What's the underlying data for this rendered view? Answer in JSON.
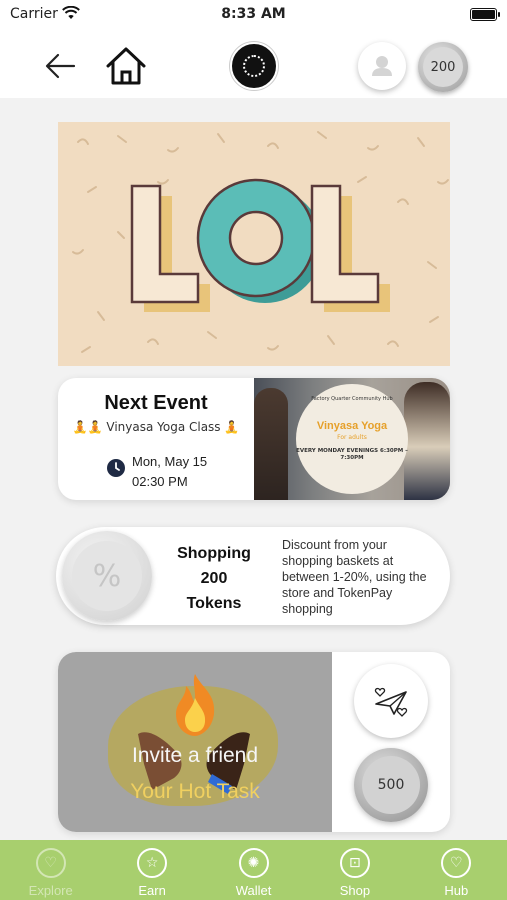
{
  "status_bar": {
    "carrier": "Carrier",
    "time": "8:33 AM"
  },
  "header": {
    "coin_balance": "200"
  },
  "banner": {
    "text": "LOL"
  },
  "next_event": {
    "title": "Next Event",
    "subtitle": "🧘🧘 Vinyasa Yoga Class 🧘",
    "date": "Mon, May 15",
    "time": "02:30 PM",
    "poster": {
      "heading": "Factory Quarter Community Hub",
      "title": "Vinyasa Yoga",
      "subtitle": "For adults",
      "schedule": "EVERY MONDAY EVENINGS 6:30PM – 7:30PM"
    }
  },
  "shopping": {
    "line1": "Shopping",
    "line2": "200",
    "line3": "Tokens",
    "symbol": "%",
    "description": "Discount from your shopping baskets at between 1-20%, using the store and TokenPay shopping"
  },
  "hot_task": {
    "title": "Invite a friend",
    "subtitle": "Your Hot Task",
    "reward": "500"
  },
  "tabs": [
    {
      "label": "Explore",
      "icon": "heart-circle-icon",
      "active": true
    },
    {
      "label": "Earn",
      "icon": "star-icon",
      "active": false
    },
    {
      "label": "Wallet",
      "icon": "coin-icon",
      "active": false
    },
    {
      "label": "Shop",
      "icon": "bag-icon",
      "active": false
    },
    {
      "label": "Hub",
      "icon": "heart-icon",
      "active": false
    }
  ],
  "colors": {
    "tabbar": "#a8cf6e",
    "banner_bg": "#f1dcc1",
    "banner_o": "#5bbdb7",
    "hot_task_subtitle": "#f0d060",
    "poster_accent": "#e6a02a"
  }
}
